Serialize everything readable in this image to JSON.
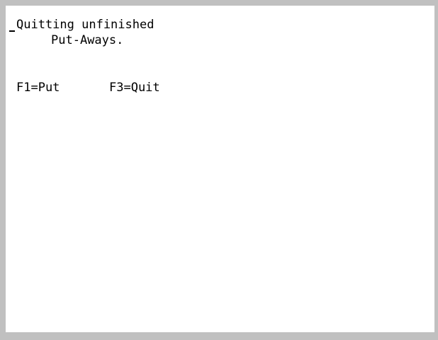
{
  "screen": {
    "message_line_1": "Quitting unfinished",
    "message_line_2": "Put-Aways.",
    "function_keys": [
      {
        "label": "F1=Put"
      },
      {
        "label": "F3=Quit"
      }
    ]
  },
  "colors": {
    "frame": "#c0c0c0",
    "screen_background": "#ffffff",
    "text": "#000000"
  }
}
